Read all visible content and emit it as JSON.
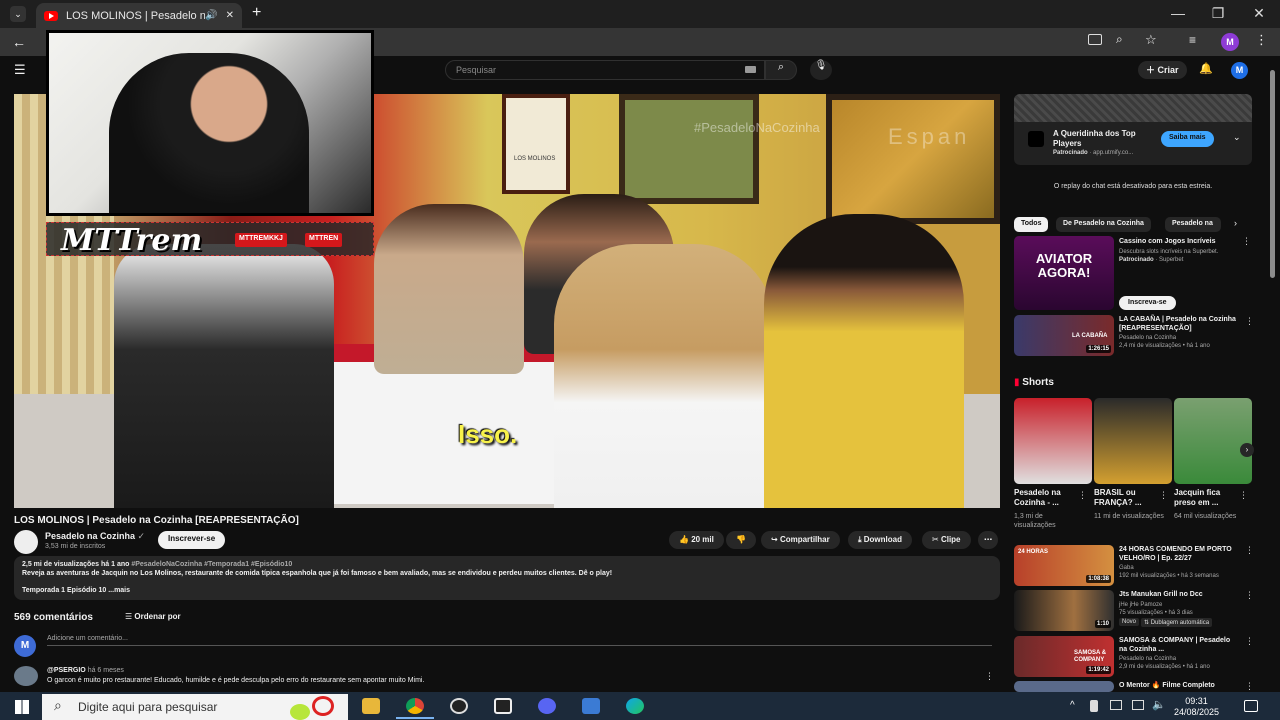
{
  "browser": {
    "tab_title": "LOS MOLINOS | Pesadelo n",
    "new_tab": "+",
    "minimize": "—",
    "maximize": "❐",
    "close": "✕"
  },
  "youtube": {
    "search_placeholder": "Pesquisar",
    "create_label": "Criar",
    "avatar_letter": "M"
  },
  "video": {
    "subtitle": "Isso.",
    "watermark": "#PesadeloNaCozinha",
    "espan_text": "Espan",
    "sign_text": "LOS MOLINOS",
    "overlay_brand": "MTTrem",
    "overlay_tag1": "MTTREMKKJ",
    "overlay_tag2": "MTTREN"
  },
  "info": {
    "title": "LOS MOLINOS | Pesadelo na Cozinha [REAPRESENTAÇÃO]",
    "channel": "Pesadelo na Cozinha",
    "subscribers": "3,53 mi de inscritos",
    "subscribe": "Inscrever-se",
    "likes": "20 mil",
    "share": "Compartilhar",
    "download": "Download",
    "clip": "Clipe",
    "views": "2,5 mi de visualizações  há 1 ano",
    "tags": "#PesadeloNaCozinha #Temporada1 #Episódio10",
    "description": "Reveja as aventuras de Jacquin no Los Molinos, restaurante de comida típica espanhola que já foi famoso e bem avaliado, mas se endividou e perdeu muitos clientes. Dê o play!",
    "season_line": "Temporada 1 Episódio 10",
    "more": "...mais"
  },
  "comments": {
    "count": "569 comentários",
    "sort": "Ordenar por",
    "add_placeholder": "Adicione um comentário...",
    "user_avatar": "M",
    "first": {
      "user": "@PSERGIO",
      "ago": "há 6 meses",
      "text": "O garcon é muito pro restaurante! Educado, humilde e é pede desculpa pelo erro do restaurante sem apontar muito Mimi."
    }
  },
  "sidebar": {
    "ad": {
      "title": "A Queridinha dos Top Players",
      "sponsor": "Patrocinado",
      "domain": "app.utmify.co...",
      "cta": "Saiba mais"
    },
    "chat_disabled": "O replay do chat está desativado para esta estreia.",
    "chips": [
      "Todos",
      "De Pesadelo na Cozinha",
      "Pesadelo na"
    ],
    "ad2": {
      "title": "Cassino com Jogos Incríveis",
      "desc": "Descubra slots incríveis na Superbet.",
      "sponsor": "Patrocinado",
      "brand": "Superbet",
      "cta": "Inscreva-se",
      "thumb_text": "AVIATOR AGORA!"
    },
    "shorts_label": "Shorts",
    "videos": [
      {
        "title": "LA CABAÑA | Pesadelo na Cozinha [REAPRESENTAÇÃO]",
        "channel": "Pesadelo na Cozinha",
        "meta": "2,4 mi de visualizações • há 1 ano",
        "duration": "1:26:15",
        "thumb_text": "LA CABAÑA"
      },
      {
        "title": "24 HORAS COMENDO EM PORTO VELHO/RO | Ep. 22/27",
        "channel": "Gaba",
        "meta": "192 mil visualizações • há 3 semanas",
        "duration": "1:08:38",
        "thumb_text": "24 HORAS"
      },
      {
        "title": "Jts Manukan Grill no Dcc",
        "channel": "jHe jHe Pamoze",
        "meta": "75 visualizações • há 3 dias",
        "duration": "1:10",
        "badge1": "Novo",
        "badge2": "Dublagem automática"
      },
      {
        "title": "SAMOSA & COMPANY | Pesadelo na Cozinha ...",
        "channel": "Pesadelo na Cozinha",
        "meta": "2,9 mi de visualizações • há 1 ano",
        "duration": "1:19:42",
        "thumb_text": "SAMOSA & COMPANY"
      },
      {
        "title": "O Mentor 🔥 Filme Completo",
        "channel": "",
        "meta": "",
        "duration": ""
      }
    ],
    "shorts": [
      {
        "title": "Pesadelo na Cozinha - ...",
        "meta": "1,3 mi de visualizações"
      },
      {
        "title": "BRASIL ou FRANÇA? ...",
        "meta": "11 mi de visualizações"
      },
      {
        "title": "Jacquin fica preso em ...",
        "meta": "64 mil visualizações"
      }
    ]
  },
  "taskbar": {
    "search": "Digite aqui para pesquisar",
    "time": "09:31",
    "date": "24/08/2025"
  },
  "colors": {
    "youtube_red": "#ff0000",
    "accent_blue": "#3ea6ff",
    "bg": "#0f0f0f"
  }
}
